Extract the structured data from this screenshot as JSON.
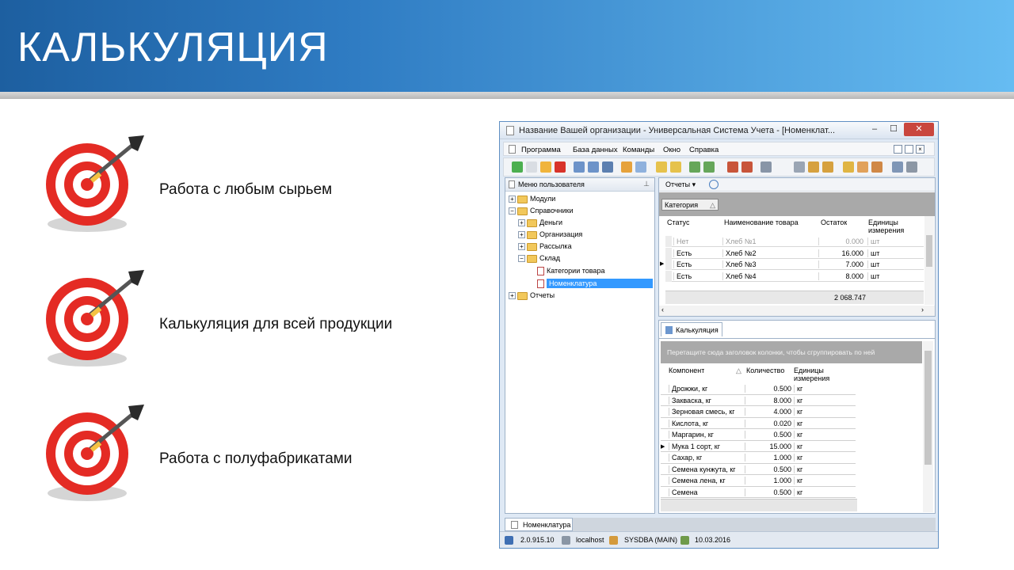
{
  "slide": {
    "title": "КАЛЬКУЛЯЦИЯ",
    "bullets": [
      "Работа с любым сырьем",
      "Калькуляция для всей продукции",
      "Работа с полуфабрикатами"
    ]
  },
  "window": {
    "title": "Название Вашей организации - Универсальная Система Учета - [Номенклат...",
    "menu": [
      "Программа",
      "База данных",
      "Команды",
      "Окно",
      "Справка"
    ],
    "left_panel": {
      "header": "Меню пользователя",
      "tree": [
        {
          "label": "Модули"
        },
        {
          "label": "Справочники"
        },
        {
          "label": "Деньги"
        },
        {
          "label": "Организация"
        },
        {
          "label": "Рассылка"
        },
        {
          "label": "Склад"
        },
        {
          "label": "Категории товара"
        },
        {
          "label": "Номенклатура"
        },
        {
          "label": "Отчеты"
        }
      ]
    },
    "reports_button": "Отчеты",
    "top_grid": {
      "group_col": "Категория",
      "headers": [
        "Статус",
        "Наименование товара",
        "Остаток",
        "Единицы измерения"
      ],
      "rows": [
        [
          "Нет",
          "Хлеб №1",
          "0.000",
          "шт"
        ],
        [
          "Есть",
          "Хлеб №2",
          "16.000",
          "шт"
        ],
        [
          "Есть",
          "Хлеб №3",
          "7.000",
          "шт"
        ],
        [
          "Есть",
          "Хлеб №4",
          "8.000",
          "шт"
        ]
      ],
      "total": "2 068.747"
    },
    "calc_tab": "Калькуляция",
    "calc_grid": {
      "group_hint": "Перетащите сюда заголовок колонки, чтобы сгруппировать по ней",
      "headers": [
        "Компонент",
        "Количество",
        "Единицы измерения"
      ],
      "rows": [
        [
          "Дрожжи, кг",
          "0.500",
          "кг"
        ],
        [
          "Закваска, кг",
          "8.000",
          "кг"
        ],
        [
          "Зерновая смесь, кг",
          "4.000",
          "кг"
        ],
        [
          "Кислота, кг",
          "0.020",
          "кг"
        ],
        [
          "Маргарин, кг",
          "0.500",
          "кг"
        ],
        [
          "Мука 1 сорт, кг",
          "15.000",
          "кг"
        ],
        [
          "Сахар, кг",
          "1.000",
          "кг"
        ],
        [
          "Семена кунжута, кг",
          "0.500",
          "кг"
        ],
        [
          "Семена лена, кг",
          "1.000",
          "кг"
        ],
        [
          "Семена",
          "0.500",
          "кг"
        ]
      ]
    },
    "bottom_tab": "Номенклатура",
    "status": {
      "version": "2.0.915.10",
      "host": "localhost",
      "user": "SYSDBA (MAIN)",
      "date": "10.03.2016"
    }
  }
}
